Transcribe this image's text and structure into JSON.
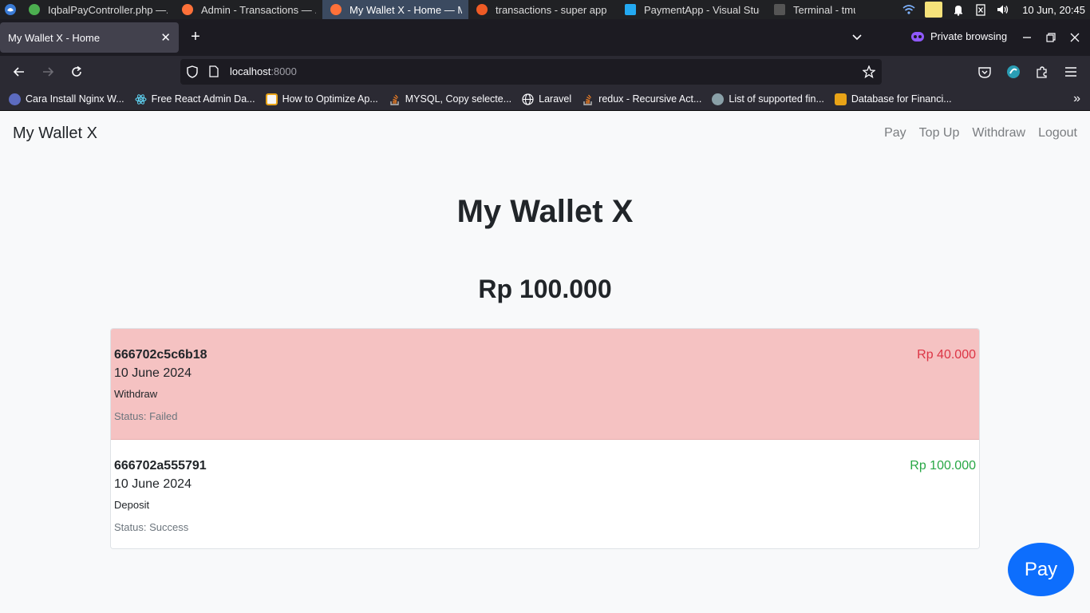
{
  "os_taskbar": {
    "tasks": [
      {
        "label": "IqbalPayController.php —...",
        "color": "#4caf50"
      },
      {
        "label": "Admin - Transactions — ...",
        "color": "#ff7139"
      },
      {
        "label": "My Wallet X - Home — M...",
        "color": "#ff7139"
      },
      {
        "label": "transactions - super app",
        "color": "#ef5b25"
      },
      {
        "label": "PaymentApp - Visual Stud...",
        "color": "#23a9f2"
      },
      {
        "label": "Terminal - tmux",
        "color": "#cccccc"
      }
    ],
    "clock": "10 Jun, 20:45"
  },
  "browser": {
    "tab_title": "My Wallet X - Home",
    "private_label": "Private browsing",
    "url_host": "localhost",
    "url_port": ":8000",
    "bookmarks": [
      {
        "label": "Cara Install Nginx W...",
        "color": "#5c6bc0"
      },
      {
        "label": "Free React Admin Da...",
        "color": "#61dafb"
      },
      {
        "label": "How to Optimize Ap...",
        "color": "#f5f5f5"
      },
      {
        "label": "MYSQL, Copy selecte...",
        "color": "#f48024"
      },
      {
        "label": "Laravel",
        "color": "#fbfbfe"
      },
      {
        "label": "redux - Recursive Act...",
        "color": "#f48024"
      },
      {
        "label": "List of supported fin...",
        "color": "#8aa0a8"
      },
      {
        "label": "Database for Financi...",
        "color": "#e8a317"
      }
    ]
  },
  "site": {
    "brand": "My Wallet X",
    "nav": [
      "Pay",
      "Top Up",
      "Withdraw",
      "Logout"
    ],
    "hero_title": "My Wallet X",
    "balance": "Rp 100.000",
    "transactions": [
      {
        "id": "666702c5c6b18",
        "date": "10 June 2024",
        "type": "Withdraw",
        "status": "Status: Failed",
        "amount": "Rp 40.000"
      },
      {
        "id": "666702a555791",
        "date": "10 June 2024",
        "type": "Deposit",
        "status": "Status: Success",
        "amount": "Rp 100.000"
      }
    ],
    "fab_label": "Pay"
  }
}
